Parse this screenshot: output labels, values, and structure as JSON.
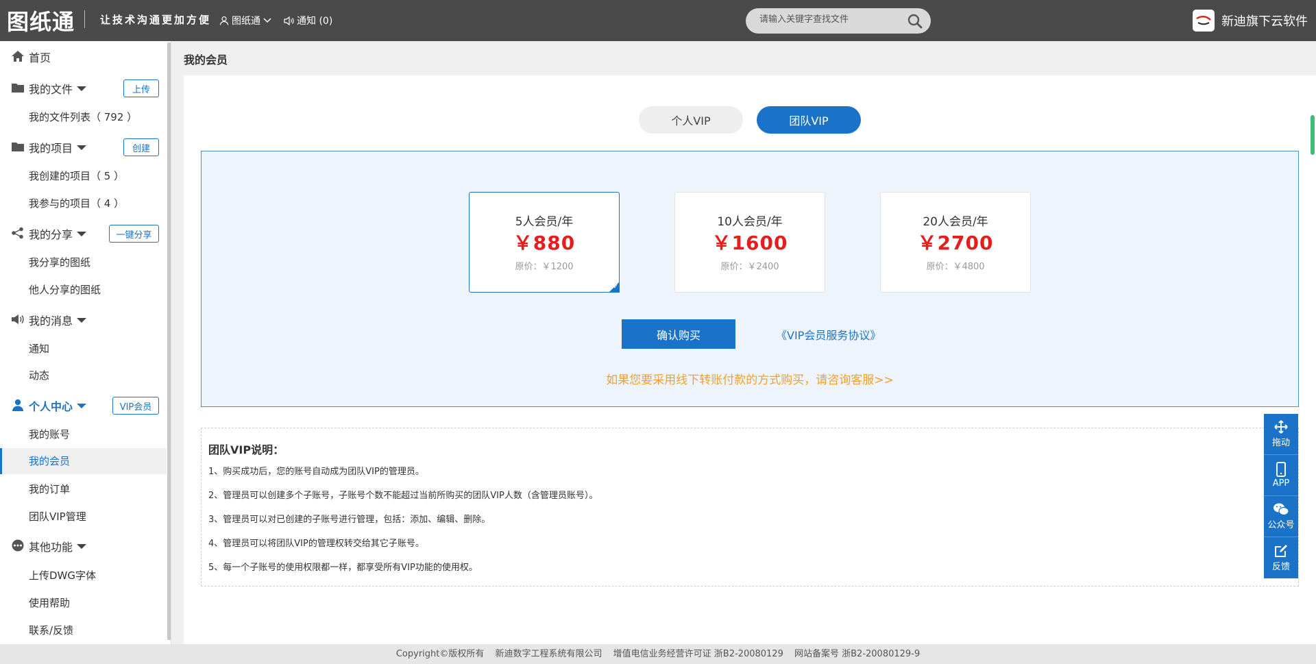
{
  "header": {
    "logo": "图纸通",
    "slogan": "让技术沟通更加方便",
    "user_menu": "图纸通",
    "notice": "通知 (0)",
    "search_placeholder": "请输入关键字查找文件",
    "brand": "新迪旗下云软件"
  },
  "sidebar": {
    "home": "首页",
    "my_files": {
      "label": "我的文件",
      "button": "上传",
      "items": [
        "我的文件列表（ 792 ）"
      ]
    },
    "my_projects": {
      "label": "我的项目",
      "button": "创建",
      "items": [
        "我创建的项目（ 5 ）",
        "我参与的项目（ 4 ）"
      ]
    },
    "my_shares": {
      "label": "我的分享",
      "button": "一键分享",
      "items": [
        "我分享的图纸",
        "他人分享的图纸"
      ]
    },
    "my_messages": {
      "label": "我的消息",
      "items": [
        "通知",
        "动态"
      ]
    },
    "personal": {
      "label": "个人中心",
      "button": "VIP会员",
      "items": [
        "我的账号",
        "我的会员",
        "我的订单",
        "团队VIP管理"
      ]
    },
    "other": {
      "label": "其他功能",
      "items": [
        "上传DWG字体",
        "使用帮助",
        "联系/反馈"
      ]
    }
  },
  "main": {
    "title": "我的会员",
    "tabs": [
      "个人VIP",
      "团队VIP"
    ],
    "active_tab": "团队VIP",
    "plans": [
      {
        "name": "5人会员/年",
        "price": "￥880",
        "original": "原价：￥1200",
        "selected": true
      },
      {
        "name": "10人会员/年",
        "price": "￥1600",
        "original": "原价：￥2400",
        "selected": false
      },
      {
        "name": "20人会员/年",
        "price": "￥2700",
        "original": "原价：￥4800",
        "selected": false
      }
    ],
    "confirm": "确认购买",
    "agreement": "《VIP会员服务协议》",
    "offline_tip": "如果您要采用线下转账付款的方式购买，请咨询客服>>",
    "notes_title": "团队VIP说明：",
    "notes": [
      "1、购买成功后，您的账号自动成为团队VIP的管理员。",
      "2、管理员可以创建多个子账号，子账号个数不能超过当前所购买的团队VIP人数（含管理员账号）。",
      "3、管理员可以对已创建的子账号进行管理，包括：添加、编辑、删除。",
      "4、管理员可以将团队VIP的管理权转交给其它子账号。",
      "5、每一个子账号的使用权限都一样，都享受所有VIP功能的使用权。"
    ]
  },
  "float_bar": [
    "拖动",
    "APP",
    "公众号",
    "反馈"
  ],
  "footer": [
    "Copyright©版权所有",
    "新迪数字工程系统有限公司",
    "增值电信业务经营许可证 浙B2-20080129",
    "网站备案号 浙B2-20080129-9"
  ],
  "colors": {
    "accent": "#1a73c8",
    "price": "#e51d1d",
    "tip": "#f0a030",
    "header_bg": "#4a4a4a"
  }
}
